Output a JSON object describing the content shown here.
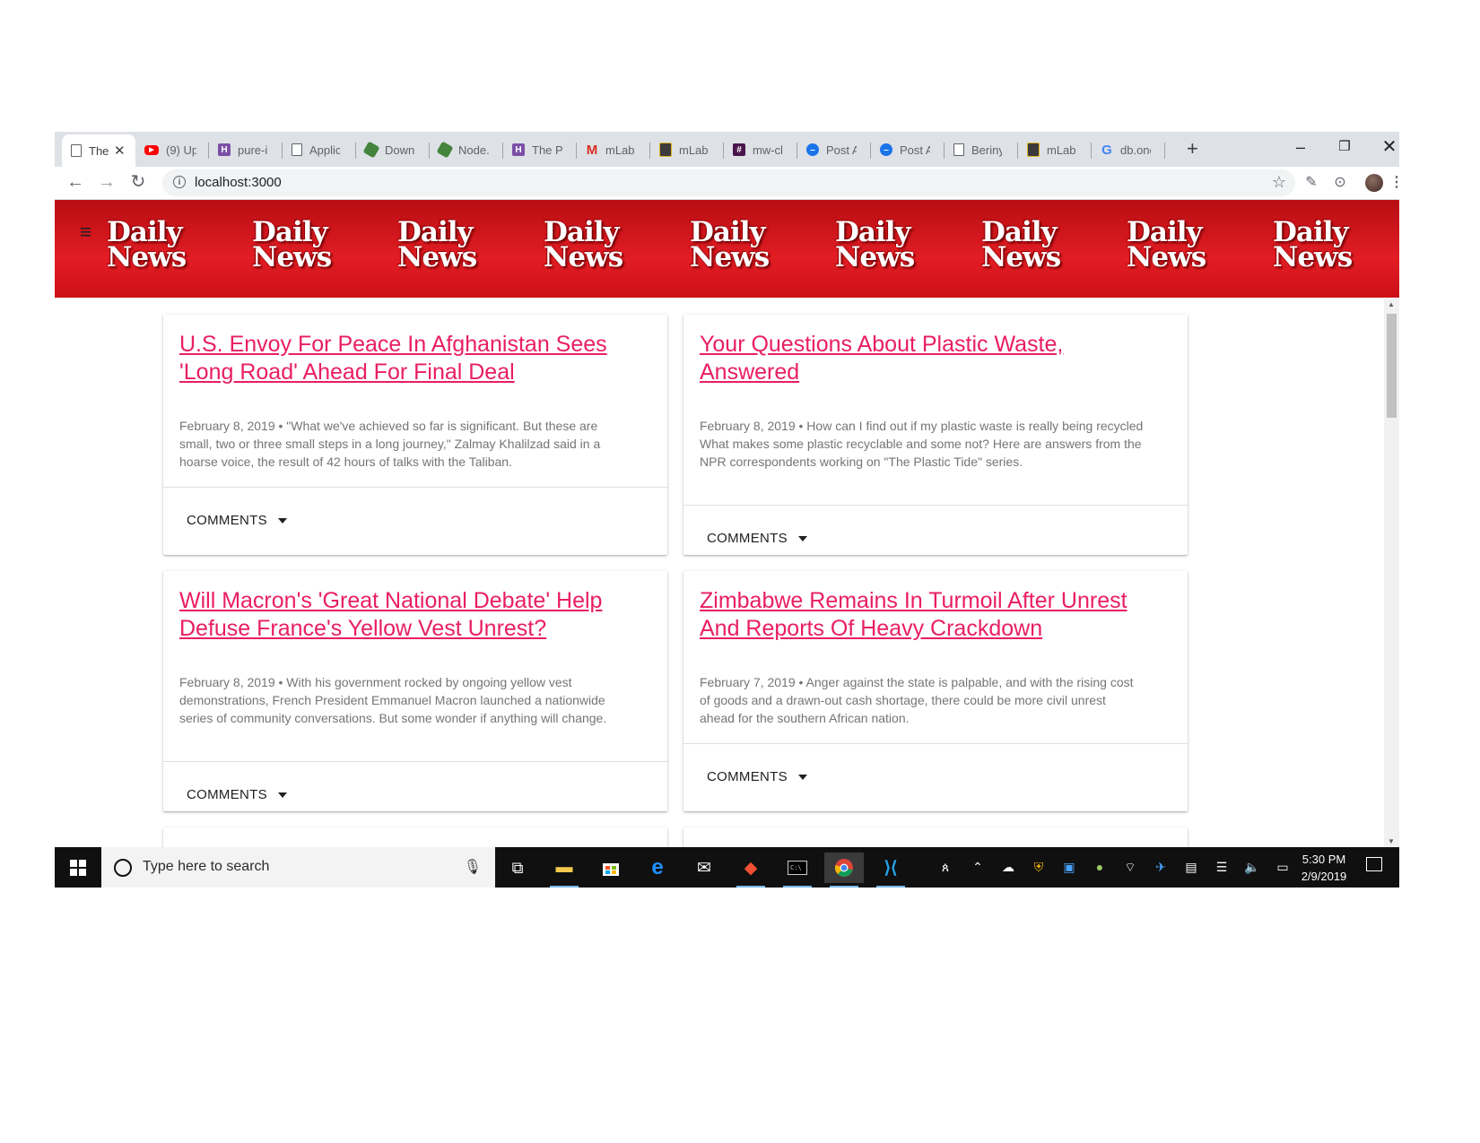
{
  "browser": {
    "tabs": [
      {
        "label": "The",
        "icon": "page-icon",
        "active": true
      },
      {
        "label": "(9) Up",
        "icon": "youtube-icon",
        "color": "#ff0000"
      },
      {
        "label": "pure-i",
        "icon": "heroku-icon",
        "color": "#7b4fa6"
      },
      {
        "label": "Applic",
        "icon": "page-icon"
      },
      {
        "label": "Downl",
        "icon": "nodejs-icon",
        "color": "#43853d"
      },
      {
        "label": "Node.j",
        "icon": "nodejs-icon",
        "color": "#43853d"
      },
      {
        "label": "The Pr",
        "icon": "heroku-icon",
        "color": "#7b4fa6"
      },
      {
        "label": "mLab",
        "icon": "gmail-icon",
        "color": "#d93025"
      },
      {
        "label": "mLab",
        "icon": "mlab-icon",
        "color": "#3b3b3b"
      },
      {
        "label": "mw-cl",
        "icon": "slack-icon",
        "color": "#4a154b"
      },
      {
        "label": "Post A",
        "icon": "circle-app-icon",
        "color": "#1a73e8"
      },
      {
        "label": "Post A",
        "icon": "circle-app-icon",
        "color": "#1a73e8"
      },
      {
        "label": "Beriny",
        "icon": "page-icon"
      },
      {
        "label": "mLab",
        "icon": "mlab-icon",
        "color": "#3b3b3b"
      },
      {
        "label": "db.onc",
        "icon": "google-icon",
        "color": "#4285f4"
      }
    ],
    "url": "localhost:3000"
  },
  "header": {
    "logo_line1": "Daily",
    "logo_line2": "News",
    "logo_count": 9,
    "color": "#d7151c"
  },
  "articles": [
    {
      "title": "U.S. Envoy For Peace In Afghanistan Sees 'Long Road' Ahead For Final Deal",
      "description": "February 8, 2019 • \"What we've achieved so far is significant. But these are small, two or three small steps in a long journey,\" Zalmay Khalilzad said in a hoarse voice, the result of 42 hours of talks with the Taliban.",
      "comments_label": "COMMENTS"
    },
    {
      "title": "Your Questions About Plastic Waste, Answered",
      "description": "February 8, 2019 • How can I find out if my plastic waste is really being recycled What makes some plastic recyclable and some not? Here are answers from the NPR correspondents working on \"The Plastic Tide\" series.",
      "comments_label": "COMMENTS"
    },
    {
      "title": "Will Macron's 'Great National Debate' Help Defuse France's Yellow Vest Unrest?",
      "description": "February 8, 2019 • With his government rocked by ongoing yellow vest demonstrations, French President Emmanuel Macron launched a nationwide series of community conversations. But some wonder if anything will change.",
      "comments_label": "COMMENTS"
    },
    {
      "title": "Zimbabwe Remains In Turmoil After Unrest And Reports Of Heavy Crackdown",
      "description": "February 7, 2019 • Anger against the state is palpable, and with the rising cost of goods and a drawn-out cash shortage, there could be more civil unrest ahead for the southern African nation.",
      "comments_label": "COMMENTS"
    }
  ],
  "colors": {
    "title_link": "#e91e63",
    "description": "#757575"
  },
  "taskbar": {
    "search_placeholder": "Type here to search",
    "time": "5:30 PM",
    "date": "2/9/2019"
  }
}
